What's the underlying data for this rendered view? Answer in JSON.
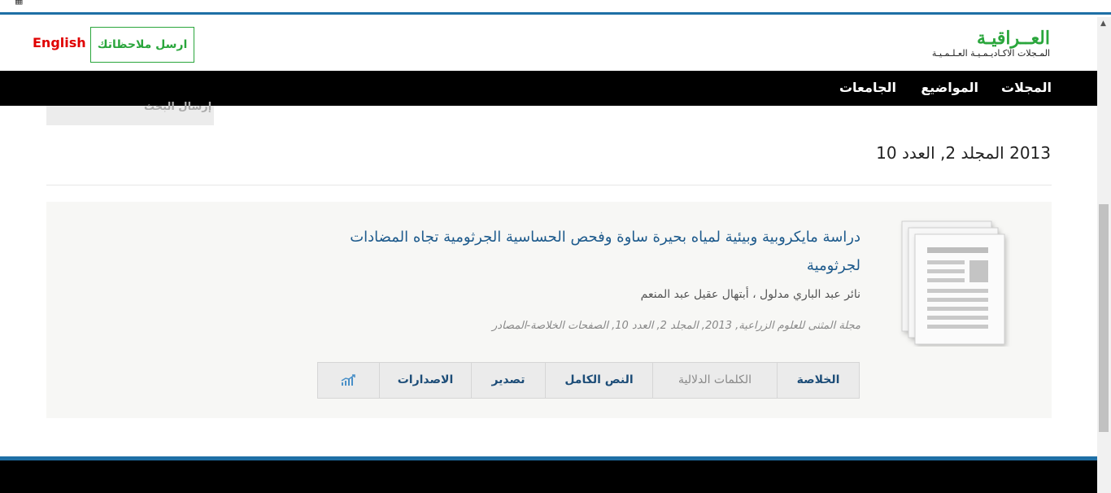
{
  "header": {
    "logo_title": "العــراقيـة",
    "logo_subtitle": "المـجلات الاكـاديـمـيـة العـلـمـيـة",
    "feedback_label": "ارسل ملاحظاتك",
    "language_label": "English"
  },
  "nav": {
    "journals": "المجلات",
    "subjects": "المواضيع",
    "universities": "الجامعات"
  },
  "sidebar": {
    "submit_label": "إرسال البحث"
  },
  "issue": {
    "title": "2013 المجلد 2, العدد 10"
  },
  "article": {
    "title": "دراسة مايكروبية وبيئية لمياه بحيرة ساوة وفحص الحساسية الجرثومية تجاه المضادات لجرثومية",
    "authors": "نائر عبد الباري مدلول ، أبتهال عقيل عبد المنعم",
    "meta": "مجلة المثنى للعلوم الزراعية, 2013, المجلد 2, العدد 10, الصفحات الخلاصة-المصادر"
  },
  "tabs": {
    "abstract": "الخلاصة",
    "keywords": "الكلمات الدلالية",
    "fulltext": "النص الكامل",
    "export": "تصدير",
    "versions": "الاصدارات"
  },
  "icons": {
    "document": "document-stack-icon",
    "stats": "bar-chart-icon"
  },
  "colors": {
    "brand_green": "#2aa63c",
    "link_blue": "#1d5a8c",
    "accent_blue": "#1e6fa5",
    "english_red": "#e00000"
  }
}
